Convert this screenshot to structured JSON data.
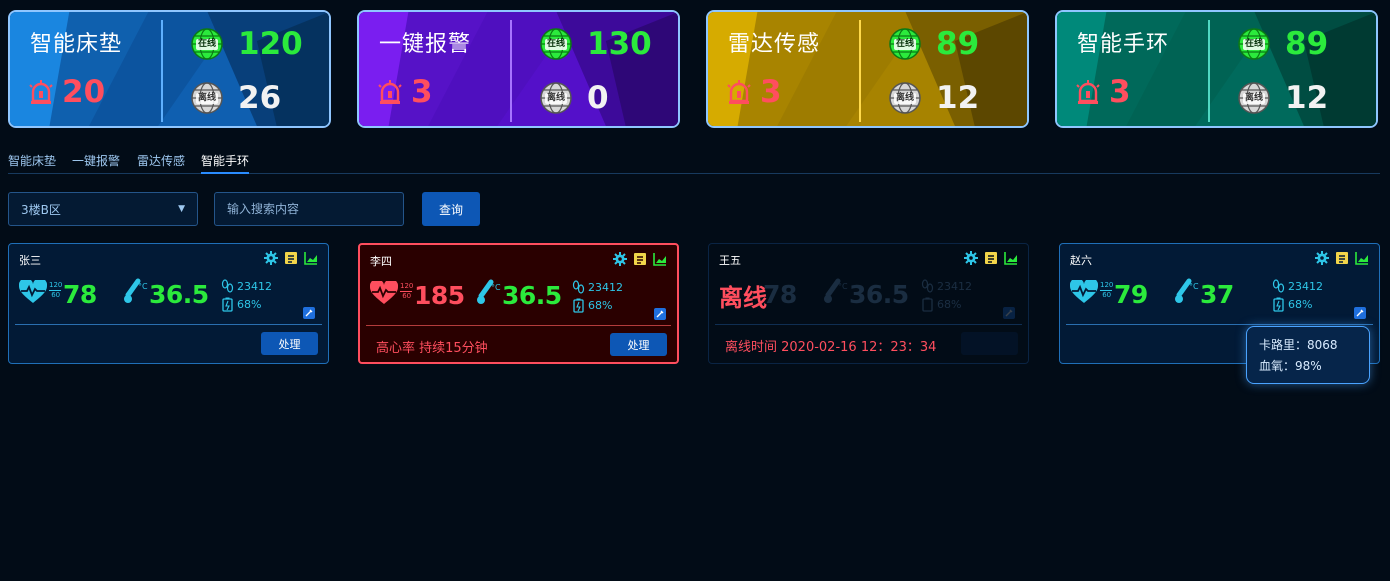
{
  "summary": [
    {
      "title": "智能床垫",
      "alarm": "20",
      "online_label": "在线",
      "online": "120",
      "offline_label": "离线",
      "offline": "26",
      "color": "#1e7fd6"
    },
    {
      "title": "一键报警",
      "alarm": "3",
      "online_label": "在线",
      "online": "130",
      "offline_label": "离线",
      "offline": "0",
      "color": "#6a12e0"
    },
    {
      "title": "雷达传感",
      "alarm": "3",
      "online_label": "在线",
      "online": "89",
      "offline_label": "离线",
      "offline": "12",
      "color": "#c9a000"
    },
    {
      "title": "智能手环",
      "alarm": "3",
      "online_label": "在线",
      "online": "89",
      "offline_label": "离线",
      "offline": "12",
      "color": "#00806e"
    }
  ],
  "tabs": [
    "智能床垫",
    "一键报警",
    "雷达传感",
    "智能手环"
  ],
  "active_tab": "智能手环",
  "filter": {
    "area": "3楼B区",
    "search_placeholder": "输入搜索内容",
    "query_label": "查询"
  },
  "devices": [
    {
      "name": "张三",
      "hr_high": "120",
      "hr_low": "60",
      "heart_rate": "78",
      "temperature": "36.5",
      "steps": "23412",
      "battery": "68%",
      "status": "",
      "action": "处理",
      "state": "normal"
    },
    {
      "name": "李四",
      "hr_high": "120",
      "hr_low": "60",
      "heart_rate": "185",
      "temperature": "36.5",
      "steps": "23412",
      "battery": "68%",
      "status": "高心率  持续15分钟",
      "action": "处理",
      "state": "alarm"
    },
    {
      "name": "王五",
      "offline_label": "离线",
      "heart_rate": "78",
      "temperature": "36.5",
      "steps": "23412",
      "battery": "68%",
      "status": "离线时间  2020-02-16  12：23：34",
      "action": "处理",
      "state": "offline"
    },
    {
      "name": "赵六",
      "hr_high": "120",
      "hr_low": "60",
      "heart_rate": "79",
      "temperature": "37",
      "steps": "23412",
      "battery": "68%",
      "status": "",
      "action": "处理",
      "state": "normal"
    }
  ],
  "tooltip": {
    "calories": "卡路里：8068",
    "spo2": "血氧：98%"
  },
  "colors": {
    "online": "#2bea3c",
    "alarm": "#ff4e5e",
    "accent": "#0d57b5",
    "cyan": "#2ec6e8"
  },
  "icons": [
    "alarm-light-icon",
    "globe-icon",
    "gear-icon",
    "note-icon",
    "chart-icon",
    "heart-pulse-icon",
    "thermometer-icon",
    "footprint-icon",
    "battery-icon",
    "edit-icon"
  ]
}
